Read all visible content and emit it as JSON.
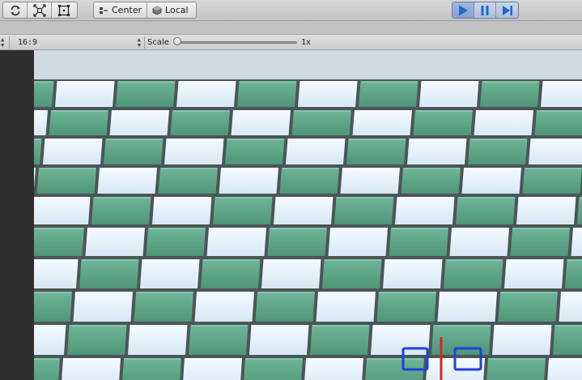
{
  "toolbar": {
    "tools": [
      {
        "name": "rotate-tool",
        "icon": "rotate-icon"
      },
      {
        "name": "scale-tool",
        "icon": "scale-icon"
      },
      {
        "name": "rect-tool",
        "icon": "rect-tool-icon"
      }
    ],
    "pivot": {
      "label": "Center",
      "icon": "pivot-icon"
    },
    "space": {
      "label": "Local",
      "icon": "local-icon"
    },
    "playback": [
      {
        "name": "play",
        "icon": "play-icon",
        "active": true
      },
      {
        "name": "pause",
        "icon": "pause-icon",
        "active": false
      },
      {
        "name": "step",
        "icon": "step-icon",
        "active": false
      }
    ],
    "accent": "#2f6fd6"
  },
  "gameview": {
    "aspect": "16:9",
    "scale_label": "Scale",
    "scale_value": "1x",
    "scale_fraction": 0.0
  },
  "scene": {
    "sky_color": "#cdd8dc",
    "tile_light": "#e4f2fb",
    "tile_green": "#5ea489",
    "grout": "#5a6568",
    "gizmo_box_color": "#2040e0",
    "gizmo_line_color": "#e02020"
  }
}
